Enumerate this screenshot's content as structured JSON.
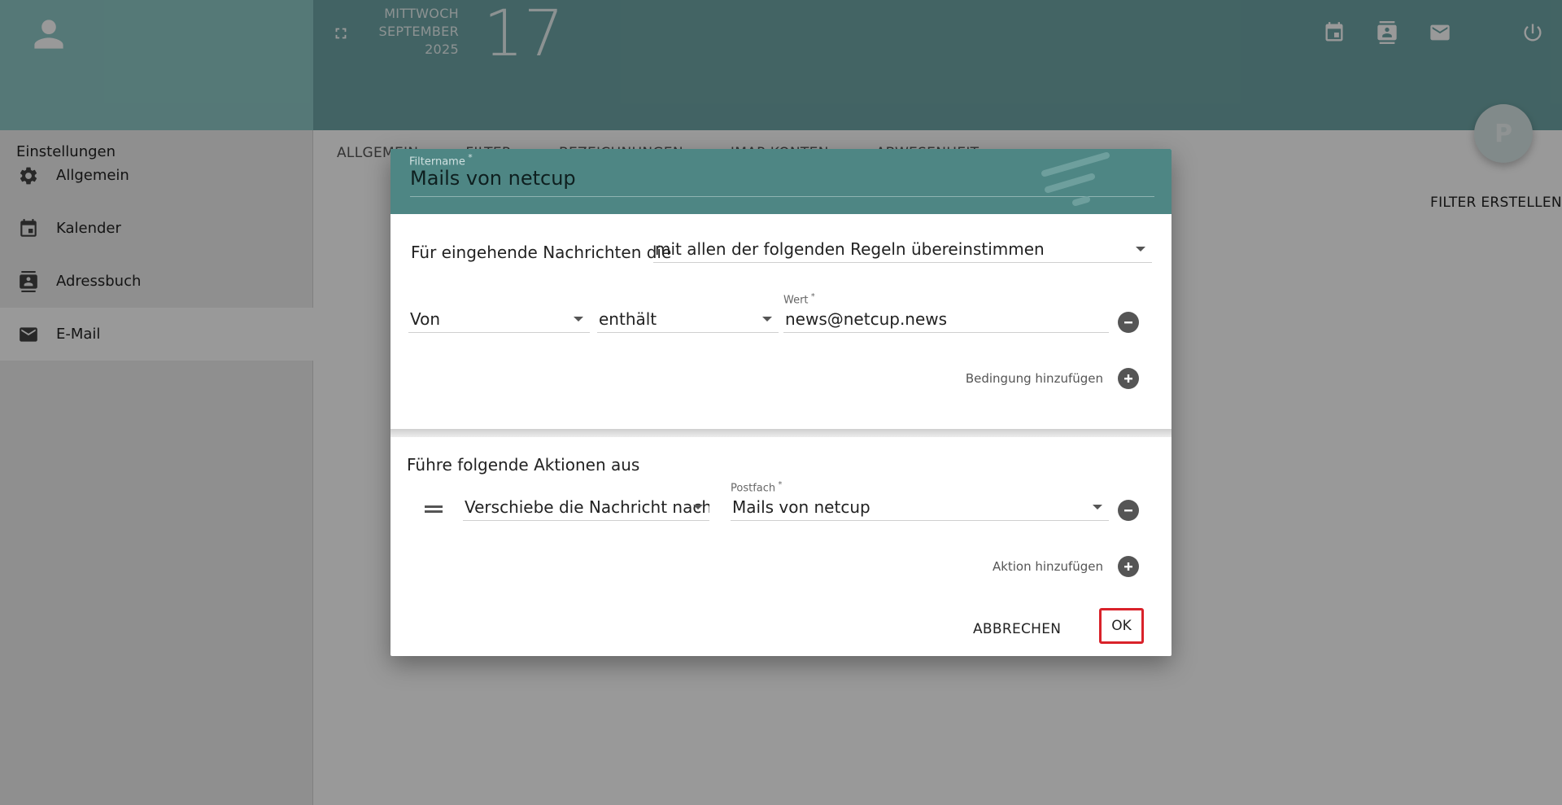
{
  "header": {
    "weekday": "MITTWOCH",
    "month": "SEPTEMBER",
    "year": "2025",
    "day": "17",
    "avatar_initial": "P"
  },
  "sidebar": {
    "title": "Einstellungen",
    "items": [
      {
        "label": "Allgemein",
        "icon": "gear-icon"
      },
      {
        "label": "Kalender",
        "icon": "calendar-icon"
      },
      {
        "label": "Adressbuch",
        "icon": "addressbook-icon"
      },
      {
        "label": "E-Mail",
        "icon": "mail-icon"
      }
    ],
    "active_index": 3
  },
  "tabs": [
    "ALLGEMEIN",
    "FILTER",
    "BEZEICHNUNGEN",
    "IMAP-KONTEN",
    "ABWESENHEIT"
  ],
  "content": {
    "create_filter_label": "FILTER ERSTELLEN"
  },
  "dialog": {
    "filtername_label": "Filtername",
    "filtername_value": "Mails von netcup",
    "incoming_prefix": "Für eingehende Nachrichten die",
    "match_mode": "mit allen der folgenden Regeln übereinstimmen",
    "condition": {
      "field": "Von",
      "operator": "enthält",
      "value_label": "Wert",
      "value": "news@netcup.news"
    },
    "add_condition_label": "Bedingung hinzufügen",
    "actions_title": "Führe folgende Aktionen aus",
    "action": {
      "type": "Verschiebe die Nachricht nach",
      "mailbox_label": "Postfach",
      "mailbox": "Mails von netcup"
    },
    "add_action_label": "Aktion hinzufügen",
    "cancel_label": "ABBRECHEN",
    "ok_label": "OK"
  },
  "colors": {
    "header_teal": "#6fa6a7",
    "dialog_header": "#4e8684",
    "ok_outline": "#d9222a"
  }
}
